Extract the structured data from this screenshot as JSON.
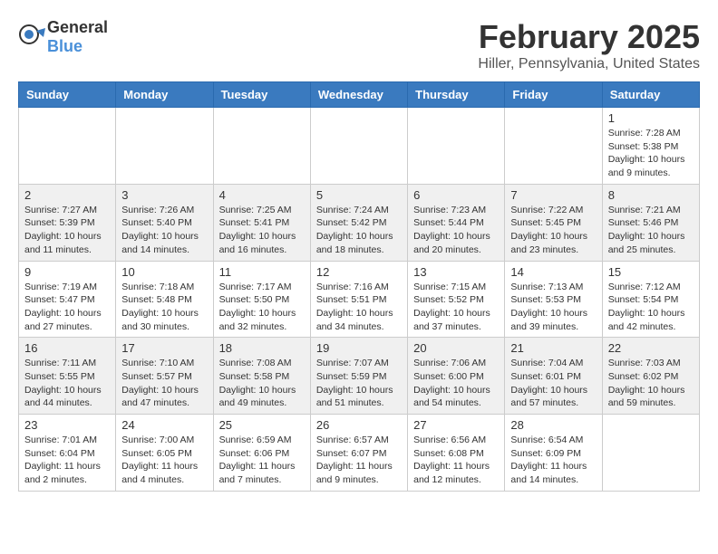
{
  "header": {
    "logo": {
      "general": "General",
      "blue": "Blue"
    },
    "title": "February 2025",
    "location": "Hiller, Pennsylvania, United States"
  },
  "calendar": {
    "days_of_week": [
      "Sunday",
      "Monday",
      "Tuesday",
      "Wednesday",
      "Thursday",
      "Friday",
      "Saturday"
    ],
    "weeks": [
      [
        {
          "day": "",
          "info": ""
        },
        {
          "day": "",
          "info": ""
        },
        {
          "day": "",
          "info": ""
        },
        {
          "day": "",
          "info": ""
        },
        {
          "day": "",
          "info": ""
        },
        {
          "day": "",
          "info": ""
        },
        {
          "day": "1",
          "info": "Sunrise: 7:28 AM\nSunset: 5:38 PM\nDaylight: 10 hours and 9 minutes."
        }
      ],
      [
        {
          "day": "2",
          "info": "Sunrise: 7:27 AM\nSunset: 5:39 PM\nDaylight: 10 hours and 11 minutes."
        },
        {
          "day": "3",
          "info": "Sunrise: 7:26 AM\nSunset: 5:40 PM\nDaylight: 10 hours and 14 minutes."
        },
        {
          "day": "4",
          "info": "Sunrise: 7:25 AM\nSunset: 5:41 PM\nDaylight: 10 hours and 16 minutes."
        },
        {
          "day": "5",
          "info": "Sunrise: 7:24 AM\nSunset: 5:42 PM\nDaylight: 10 hours and 18 minutes."
        },
        {
          "day": "6",
          "info": "Sunrise: 7:23 AM\nSunset: 5:44 PM\nDaylight: 10 hours and 20 minutes."
        },
        {
          "day": "7",
          "info": "Sunrise: 7:22 AM\nSunset: 5:45 PM\nDaylight: 10 hours and 23 minutes."
        },
        {
          "day": "8",
          "info": "Sunrise: 7:21 AM\nSunset: 5:46 PM\nDaylight: 10 hours and 25 minutes."
        }
      ],
      [
        {
          "day": "9",
          "info": "Sunrise: 7:19 AM\nSunset: 5:47 PM\nDaylight: 10 hours and 27 minutes."
        },
        {
          "day": "10",
          "info": "Sunrise: 7:18 AM\nSunset: 5:48 PM\nDaylight: 10 hours and 30 minutes."
        },
        {
          "day": "11",
          "info": "Sunrise: 7:17 AM\nSunset: 5:50 PM\nDaylight: 10 hours and 32 minutes."
        },
        {
          "day": "12",
          "info": "Sunrise: 7:16 AM\nSunset: 5:51 PM\nDaylight: 10 hours and 34 minutes."
        },
        {
          "day": "13",
          "info": "Sunrise: 7:15 AM\nSunset: 5:52 PM\nDaylight: 10 hours and 37 minutes."
        },
        {
          "day": "14",
          "info": "Sunrise: 7:13 AM\nSunset: 5:53 PM\nDaylight: 10 hours and 39 minutes."
        },
        {
          "day": "15",
          "info": "Sunrise: 7:12 AM\nSunset: 5:54 PM\nDaylight: 10 hours and 42 minutes."
        }
      ],
      [
        {
          "day": "16",
          "info": "Sunrise: 7:11 AM\nSunset: 5:55 PM\nDaylight: 10 hours and 44 minutes."
        },
        {
          "day": "17",
          "info": "Sunrise: 7:10 AM\nSunset: 5:57 PM\nDaylight: 10 hours and 47 minutes."
        },
        {
          "day": "18",
          "info": "Sunrise: 7:08 AM\nSunset: 5:58 PM\nDaylight: 10 hours and 49 minutes."
        },
        {
          "day": "19",
          "info": "Sunrise: 7:07 AM\nSunset: 5:59 PM\nDaylight: 10 hours and 51 minutes."
        },
        {
          "day": "20",
          "info": "Sunrise: 7:06 AM\nSunset: 6:00 PM\nDaylight: 10 hours and 54 minutes."
        },
        {
          "day": "21",
          "info": "Sunrise: 7:04 AM\nSunset: 6:01 PM\nDaylight: 10 hours and 57 minutes."
        },
        {
          "day": "22",
          "info": "Sunrise: 7:03 AM\nSunset: 6:02 PM\nDaylight: 10 hours and 59 minutes."
        }
      ],
      [
        {
          "day": "23",
          "info": "Sunrise: 7:01 AM\nSunset: 6:04 PM\nDaylight: 11 hours and 2 minutes."
        },
        {
          "day": "24",
          "info": "Sunrise: 7:00 AM\nSunset: 6:05 PM\nDaylight: 11 hours and 4 minutes."
        },
        {
          "day": "25",
          "info": "Sunrise: 6:59 AM\nSunset: 6:06 PM\nDaylight: 11 hours and 7 minutes."
        },
        {
          "day": "26",
          "info": "Sunrise: 6:57 AM\nSunset: 6:07 PM\nDaylight: 11 hours and 9 minutes."
        },
        {
          "day": "27",
          "info": "Sunrise: 6:56 AM\nSunset: 6:08 PM\nDaylight: 11 hours and 12 minutes."
        },
        {
          "day": "28",
          "info": "Sunrise: 6:54 AM\nSunset: 6:09 PM\nDaylight: 11 hours and 14 minutes."
        },
        {
          "day": "",
          "info": ""
        }
      ]
    ]
  }
}
